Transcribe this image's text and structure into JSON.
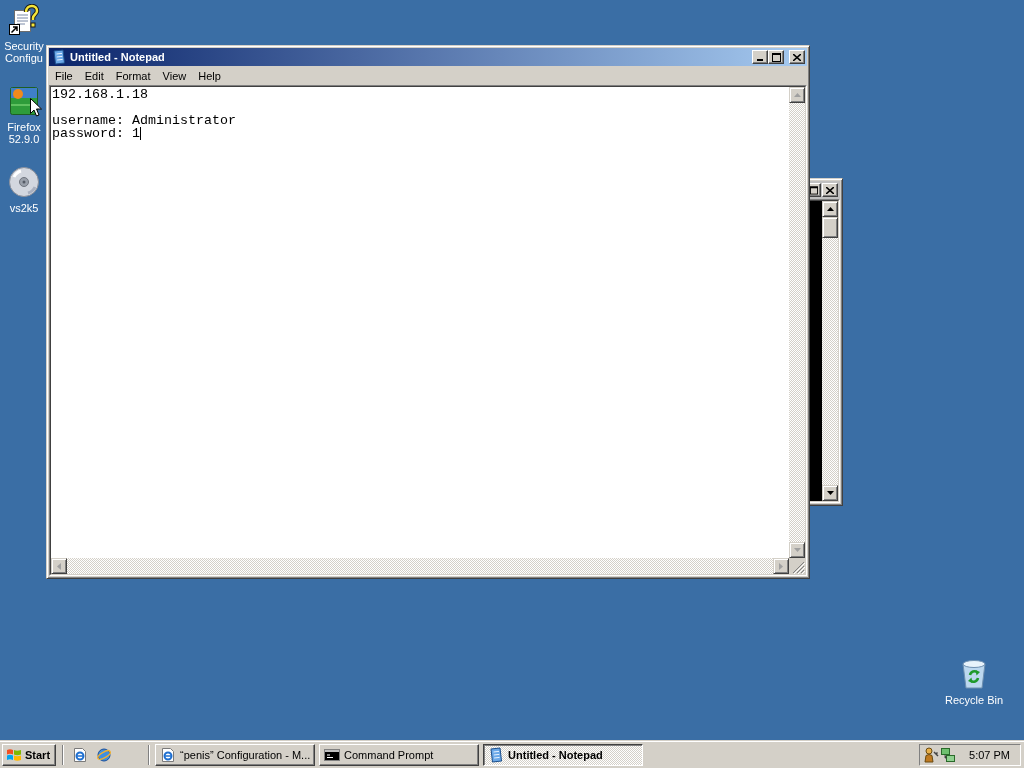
{
  "desktop": {
    "icons": [
      {
        "label": "Security Configu",
        "kind": "shortcut-document",
        "selected": false
      },
      {
        "label": "Firefox 52.9.0",
        "kind": "application",
        "selected": false
      },
      {
        "label": "vs2k5",
        "kind": "disc",
        "selected": false
      }
    ],
    "recycle_bin": {
      "label": "Recycle Bin",
      "selected": false
    }
  },
  "background_window": {
    "active": false,
    "scroll_disabled": false
  },
  "notepad_window": {
    "active": true,
    "title": "Untitled - Notepad",
    "menu": [
      {
        "label": "File"
      },
      {
        "label": "Edit"
      },
      {
        "label": "Format"
      },
      {
        "label": "View"
      },
      {
        "label": "Help"
      }
    ],
    "text": "192.168.1.18\n\nusername: Administrator\npassword: 1",
    "caret": true,
    "scroll_disabled": true
  },
  "taskbar": {
    "start": "Start",
    "tasks": [
      {
        "label": "“penis” Configuration - M...",
        "kind": "browser",
        "selected": false
      },
      {
        "label": "Command Prompt",
        "kind": "console",
        "selected": false
      },
      {
        "label": "Untitled - Notepad",
        "kind": "notepad",
        "selected": true
      }
    ],
    "clock": "5:07 PM"
  }
}
